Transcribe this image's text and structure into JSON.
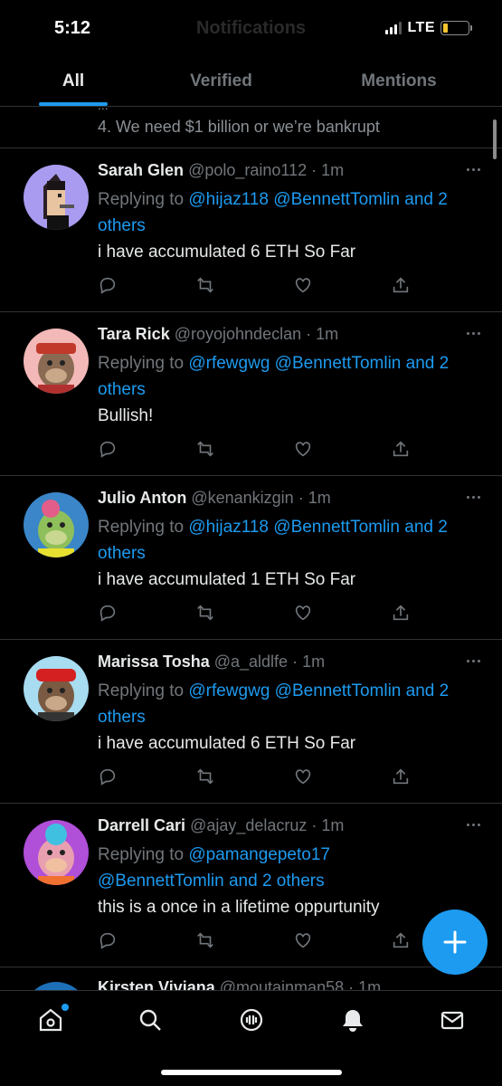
{
  "status_bar": {
    "time": "5:12",
    "network": "LTE"
  },
  "header": {
    "title": "Notifications"
  },
  "tabs": [
    {
      "label": "All",
      "active": true
    },
    {
      "label": "Verified",
      "active": false
    },
    {
      "label": "Mentions",
      "active": false
    }
  ],
  "partial_top": {
    "cut_text": "...",
    "text": "4. We need $1 billion or we’re bankrupt"
  },
  "tweets": [
    {
      "name": "Sarah Glen",
      "handle": "@polo_raino112",
      "sep": " · ",
      "time": "1m",
      "replying_prefix": "Replying to ",
      "mention1": "@hijaz118",
      "mention2": "@BennettTomlin",
      "mention_tail": " and 2 others",
      "body": "i have accumulated 6 ETH So Far"
    },
    {
      "name": "Tara Rick",
      "handle": "@royojohndeclan",
      "sep": " · ",
      "time": "1m",
      "replying_prefix": "Replying to ",
      "mention1": "@rfewgwg",
      "mention2": "@BennettTomlin",
      "mention_tail": " and 2 others",
      "body": "Bullish!"
    },
    {
      "name": "Julio Anton",
      "handle": "@kenankizgin",
      "sep": " · ",
      "time": "1m",
      "replying_prefix": "Replying to ",
      "mention1": "@hijaz118",
      "mention2": "@BennettTomlin",
      "mention_tail": " and 2 others",
      "body": "i have accumulated 1 ETH So Far"
    },
    {
      "name": "Marissa Tosha",
      "handle": "@a_aldlfe",
      "sep": " · ",
      "time": "1m",
      "replying_prefix": "Replying to ",
      "mention1": "@rfewgwg",
      "mention2": "@BennettTomlin",
      "mention_tail": " and 2 others",
      "body": "i have accumulated 6 ETH So Far"
    },
    {
      "name": "Darrell Cari",
      "handle": "@ajay_delacruz",
      "sep": " · ",
      "time": "1m",
      "replying_prefix": "Replying to ",
      "mention1": "@pamangepeto17",
      "mention2": "@BennettTomlin",
      "mention_tail": " and 2 others",
      "body": "this is a once in a lifetime oppurtunity"
    }
  ],
  "partial_bottom": {
    "name": "Kirsten Viviana",
    "handle": "@moutainman58",
    "sep": " · ",
    "time": "1m"
  },
  "icons": {
    "reply": "reply-icon",
    "retweet": "retweet-icon",
    "like": "like-icon",
    "share": "share-icon",
    "home": "home-icon",
    "search": "search-icon",
    "spaces": "spaces-icon",
    "notifications": "bell-icon",
    "messages": "mail-icon",
    "compose": "plus-icon"
  },
  "colors": {
    "accent": "#1d9bf0",
    "background": "#000000",
    "muted": "#71767b"
  }
}
